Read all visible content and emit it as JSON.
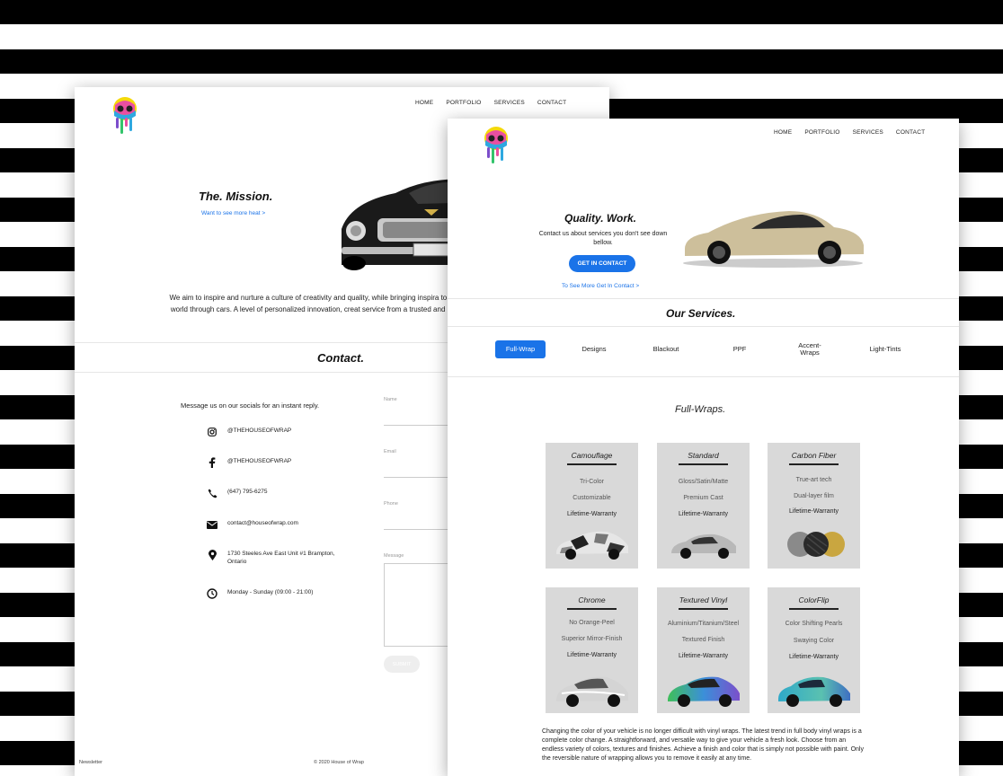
{
  "left_page": {
    "nav": [
      "HOME",
      "PORTFOLIO",
      "SERVICES",
      "CONTACT"
    ],
    "mission_title": "The. Mission.",
    "mission_link": "Want to see more heat >",
    "mission_text": "We aim to inspire and nurture a culture of creativity and quality, while bringing inspira to every person in the world through cars. A level of personalized innovation, creat service from a trusted and experienced brand.",
    "contact_title": "Contact.",
    "social_intro": "Message us on our socials for an instant reply.",
    "contacts": [
      {
        "icon": "instagram-icon",
        "text": "@THEHOUSEOFWRAP"
      },
      {
        "icon": "facebook-icon",
        "text": "@THEHOUSEOFWRAP"
      },
      {
        "icon": "phone-icon",
        "text": "(647) 795-6275"
      },
      {
        "icon": "mail-icon",
        "text": "contact@houseofwrap.com"
      },
      {
        "icon": "location-pin-icon",
        "text": "1730 Steeles Ave East Unit #1 Brampton, Ontario"
      },
      {
        "icon": "clock-icon",
        "text": "Monday - Sunday (09:00 - 21:00)"
      }
    ],
    "form": {
      "name_label": "Name",
      "email_label": "Email",
      "phone_label": "Phone",
      "message_label": "Message",
      "submit_label": "SUBMIT"
    },
    "footer_left": "Newsletter",
    "footer_copy": "© 2020 House of Wrap"
  },
  "right_page": {
    "nav": [
      "HOME",
      "PORTFOLIO",
      "SERVICES",
      "CONTACT"
    ],
    "quality_title": "Quality. Work.",
    "quality_sub": "Contact us about services you don't see down bellow.",
    "cta_button": "GET IN CONTACT",
    "cta_link": "To See More Get In Contact >",
    "services_title": "Our Services.",
    "tabs": [
      "Full-Wrap",
      "Designs",
      "Blackout",
      "PPF",
      "Accent-Wraps",
      "Light-Tints"
    ],
    "active_tab": "Full-Wrap",
    "section_title": "Full-Wraps.",
    "cards": [
      {
        "title": "Camouflage",
        "features": [
          "Tri-Color",
          "Customizable",
          "Lifetime-Warranty"
        ]
      },
      {
        "title": "Standard",
        "features": [
          "Gloss/Satin/Matte",
          "Premium Cast",
          "Lifetime-Warranty"
        ]
      },
      {
        "title": "Carbon Fiber",
        "features": [
          "True-art tech",
          "Dual-layer film",
          "Lifetime-Warranty"
        ]
      },
      {
        "title": "Chrome",
        "features": [
          "No Orange-Peel",
          "Superior Mirror-Finish",
          "Lifetime-Warranty"
        ]
      },
      {
        "title": "Textured Vinyl",
        "features": [
          "Aluminium/Titanium/Steel",
          "Textured Finish",
          "Lifetime-Warranty"
        ]
      },
      {
        "title": "ColorFlip",
        "features": [
          "Color Shifting Pearls",
          "Swaying Color",
          "Lifetime-Warranty"
        ]
      }
    ],
    "description": "Changing the color of your vehicle is no longer difficult with vinyl wraps. The latest trend in full body vinyl wraps is a complete color change. A straightforward, and versatile way to give your vehicle a fresh look. Choose from an endless variety of colors, textures and finishes. Achieve a finish and color that is simply not possible with paint. Only the reversible nature of wrapping allows you to remove it easily at any time."
  },
  "colors": {
    "accent": "#1a73e8",
    "card_bg": "#d9d9d9",
    "stripe": "#000000"
  }
}
